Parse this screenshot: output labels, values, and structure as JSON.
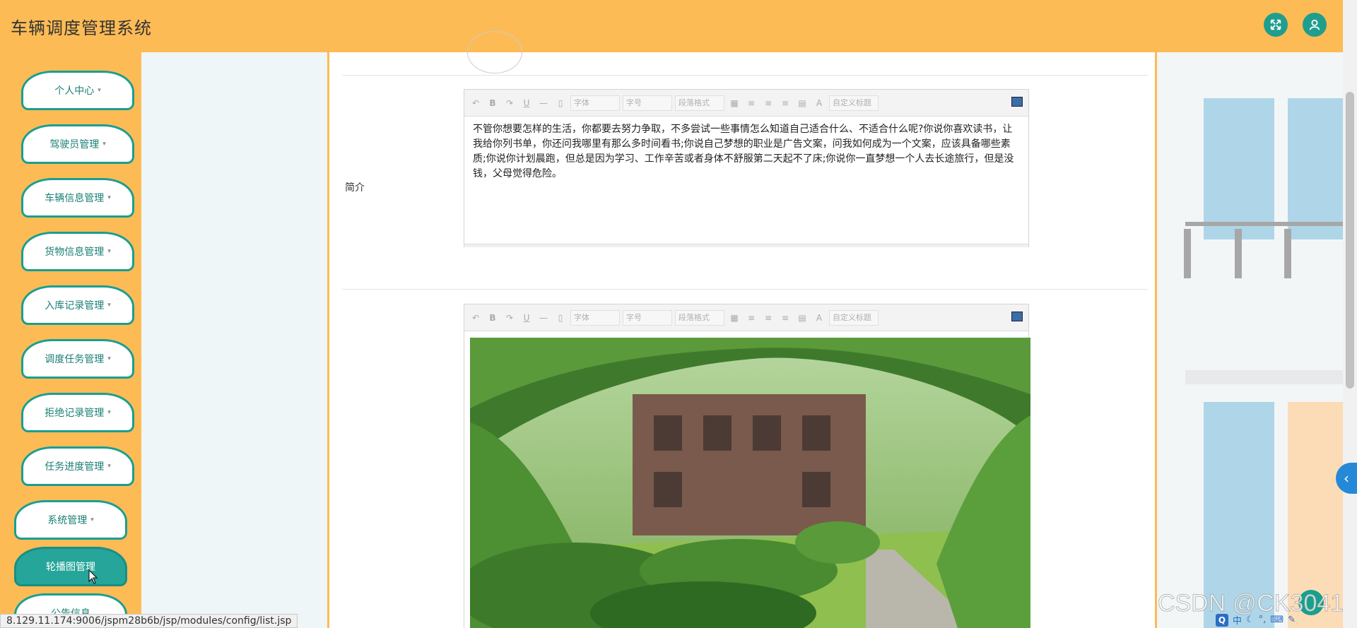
{
  "app": {
    "title": "车辆调度管理系统"
  },
  "header": {
    "fullscreen_icon": "expand-arrows-icon",
    "user_icon": "user-icon"
  },
  "sidebar": {
    "items": [
      {
        "label": "个人中心",
        "caret": "▾"
      },
      {
        "label": "驾驶员管理",
        "caret": "▾"
      },
      {
        "label": "车辆信息管理",
        "caret": "▾"
      },
      {
        "label": "货物信息管理",
        "caret": "▾"
      },
      {
        "label": "入库记录管理",
        "caret": "▾"
      },
      {
        "label": "调度任务管理",
        "caret": "▾"
      },
      {
        "label": "拒绝记录管理",
        "caret": "▾"
      },
      {
        "label": "任务进度管理",
        "caret": "▾"
      },
      {
        "label": "系统管理",
        "caret": "▾"
      },
      {
        "label": "轮播图管理",
        "caret": ""
      },
      {
        "label": "公告信息",
        "caret": ""
      }
    ]
  },
  "form": {
    "intro_label": "简介",
    "intro_text": "不管你想要怎样的生活，你都要去努力争取，不多尝试一些事情怎么知道自己适合什么、不适合什么呢?你说你喜欢读书，让我给你列书单，你还问我哪里有那么多时间看书;你说自己梦想的职业是广告文案，问我如何成为一个文案，应该具备哪些素质;你说你计划晨跑，但总是因为学习、工作辛苦或者身体不舒服第二天起不了床;你说你一直梦想一个人去长途旅行，但是没钱，父母觉得危险。"
  },
  "editor_toolbar": {
    "font_family": "字体",
    "font_size": "字号",
    "paragraph": "段落格式",
    "custom_title": "自定义标题",
    "bold": "B",
    "underline": "U",
    "font_color": "A"
  },
  "status_bar": {
    "url": "8.129.11.174:9006/jspm28b6b/jsp/modules/config/list.jsp"
  },
  "watermark": {
    "text": "CSDN @CK3041"
  },
  "tray": {
    "ime_q": "Q",
    "ime_lang": "中"
  }
}
